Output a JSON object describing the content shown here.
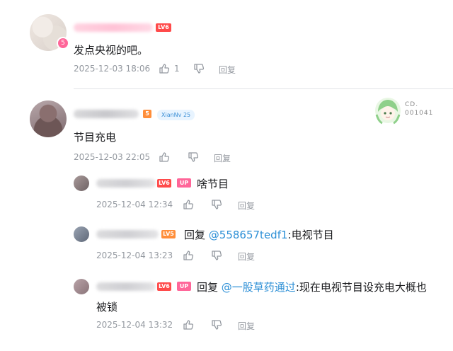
{
  "comments": [
    {
      "level": "LV6",
      "vip_badge": "5",
      "text": "发点央视的吧。",
      "time": "2025-12-03 18:06",
      "likes": "1",
      "reply_label": "回复"
    },
    {
      "level": "5",
      "fan_badge": "XianNv 25",
      "text": "节目充电",
      "time": "2025-12-03 22:05",
      "reply_label": "回复",
      "decoration": {
        "line1": "CD.",
        "line2": "001041"
      },
      "replies": [
        {
          "level": "LV6",
          "up_badge": "UP",
          "text": "啥节目",
          "time": "2025-12-04 12:34",
          "reply_label": "回复"
        },
        {
          "level": "LV5",
          "prefix": "回复",
          "mention": "@558657tedf1",
          "text": ":电视节目",
          "time": "2025-12-04 13:23",
          "reply_label": "回复"
        },
        {
          "level": "LV6",
          "up_badge": "UP",
          "prefix": "回复",
          "mention": "@一股草药通过",
          "text": ":现在电视节目设充电大概也",
          "text_line2": "被锁",
          "time": "2025-12-04 13:32",
          "reply_label": "回复"
        }
      ]
    }
  ],
  "icons": {
    "like": "thumbs-up-icon",
    "dislike": "thumbs-down-icon"
  },
  "colors": {
    "mention": "#2c8fd6",
    "up_badge": "#ff6699",
    "lv6": "#ff4a4a",
    "lv5": "#ff8e3a",
    "meta": "#9499a0"
  }
}
